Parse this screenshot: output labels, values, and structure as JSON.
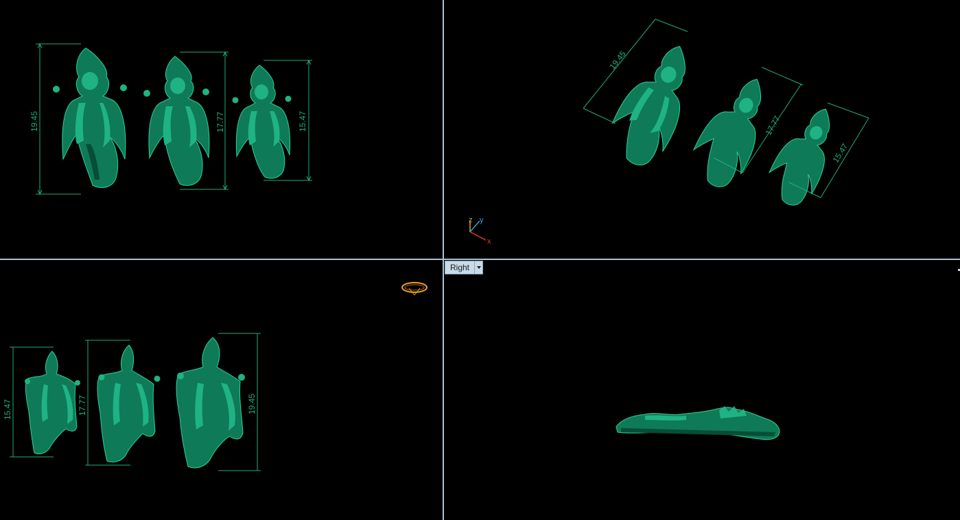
{
  "viewports": {
    "top": {
      "dimensions": [
        "19.45",
        "17.77",
        "15.47"
      ]
    },
    "perspective": {
      "dimensions": [
        "19.45",
        "17.77",
        "15.47"
      ],
      "axis": {
        "z": "z",
        "y": "y",
        "x": "x"
      }
    },
    "front": {
      "dimensions": [
        "15.47",
        "17.77",
        "19.45"
      ]
    },
    "right": {
      "label": "Right"
    }
  },
  "colors": {
    "background": "#000000",
    "divider": "#a9c4d6",
    "model": "#0f7a58",
    "dimension": "#1fae7a",
    "axis_x": "#e03a2a",
    "axis_y": "#2aa3e0",
    "axis_z": "#e0a02a",
    "selection": "#f0a020"
  },
  "icons": [
    "gumball-icon",
    "axis-triad-icon",
    "dropdown-arrow-icon"
  ]
}
